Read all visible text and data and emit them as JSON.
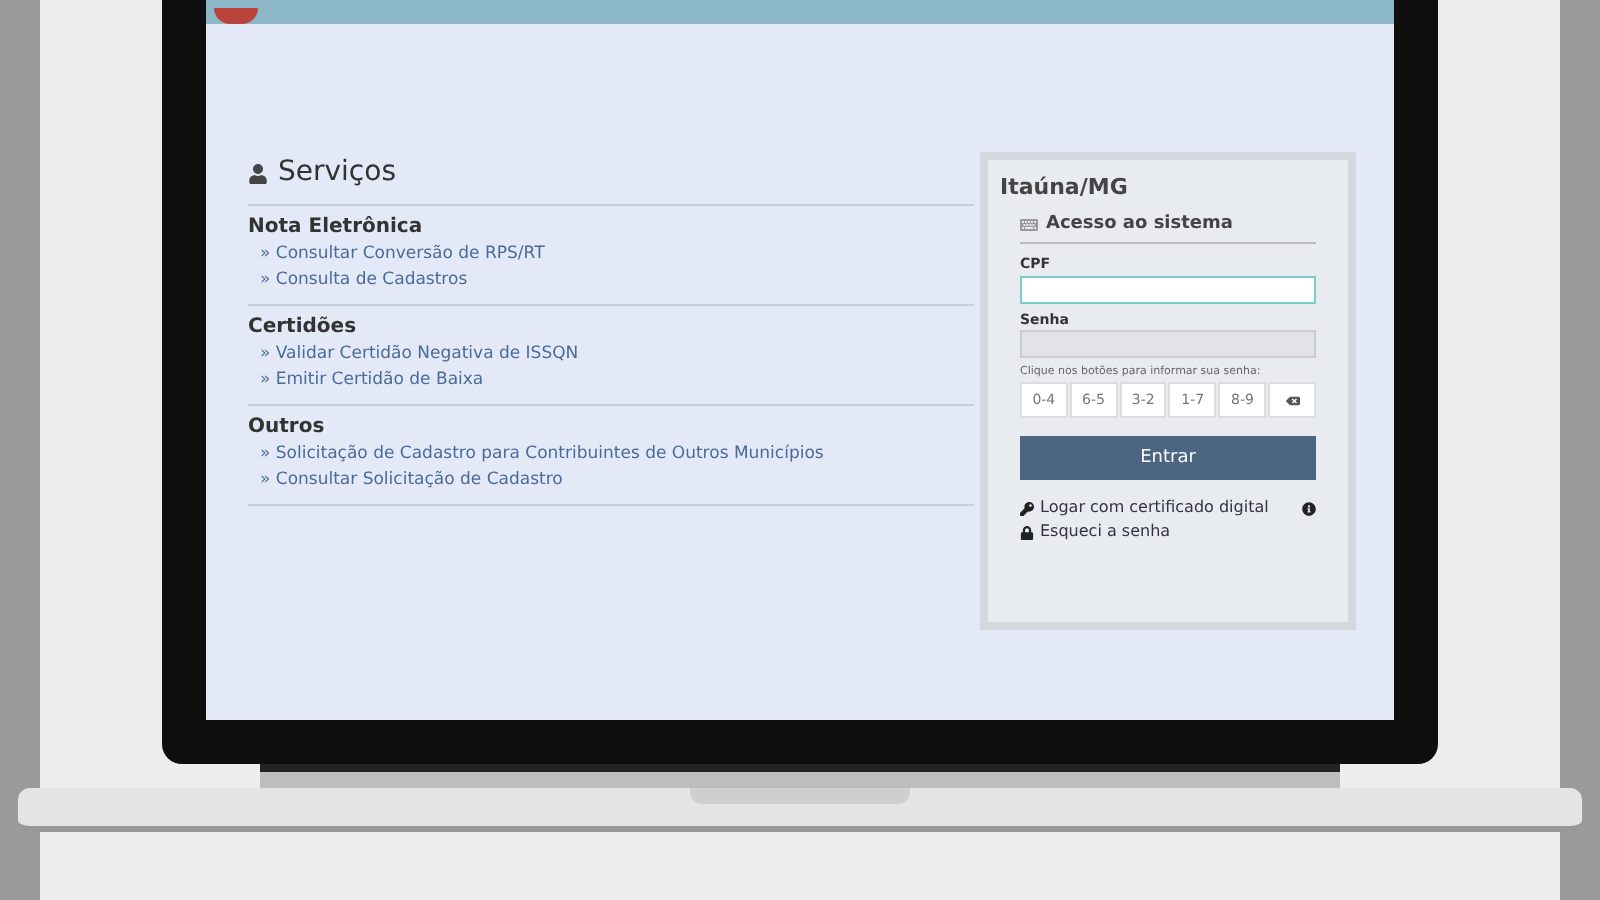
{
  "services": {
    "title": "Serviços",
    "groups": [
      {
        "title": "Nota Eletrônica",
        "links": [
          "» Consultar Conversão de RPS/RT",
          "» Consulta de Cadastros"
        ]
      },
      {
        "title": "Certidões",
        "links": [
          "» Validar Certidão Negativa de ISSQN",
          "» Emitir Certidão de Baixa"
        ]
      },
      {
        "title": "Outros",
        "links": [
          "» Solicitação de Cadastro para Contribuintes de Outros Municípios",
          "» Consultar Solicitação de Cadastro"
        ]
      }
    ]
  },
  "login": {
    "city": "Itaúna/MG",
    "heading": "Acesso ao sistema",
    "cpf_label": "CPF",
    "password_label": "Senha",
    "keypad_hint": "Clique nos botões para informar sua senha:",
    "keys": [
      "0-4",
      "6-5",
      "3-2",
      "1-7",
      "8-9"
    ],
    "submit": "Entrar",
    "certificate_link": "Logar com certificado digital",
    "forgot_link": "Esqueci a senha"
  }
}
